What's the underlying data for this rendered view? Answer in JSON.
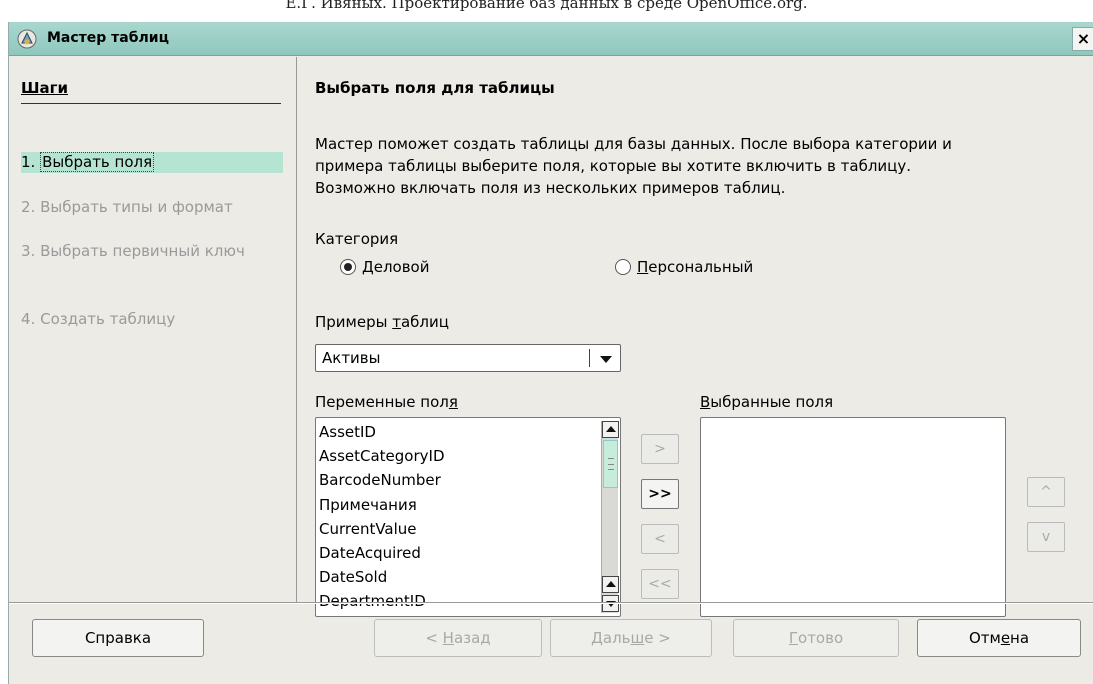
{
  "page_header": "Е.Г. Ивяных. Проектирование баз данных в среде OpenOffice.org.",
  "window": {
    "title": "Мастер таблиц",
    "icon": "wizard-icon",
    "close_label": "×"
  },
  "steps": {
    "title": "Шаги",
    "items": [
      {
        "number": "1.",
        "label": "Выбрать поля",
        "active": true
      },
      {
        "number": "2.",
        "label": "Выбрать типы и формат",
        "active": false
      },
      {
        "number": "3.",
        "label": "Выбрать первичный ключ",
        "active": false
      },
      {
        "number": "4.",
        "label": "Создать таблицу",
        "active": false
      }
    ]
  },
  "main": {
    "heading": "Выбрать поля для таблицы",
    "intro_lines": [
      "Мастер поможет создать таблицы для базы данных. После выбора категории и",
      "примера таблицы выберите поля, которые вы хотите включить в таблицу.",
      "Возможно включать поля из нескольких примеров таблиц."
    ],
    "category_label": "Категория",
    "category_options": [
      {
        "pre": "",
        "key": "Д",
        "post": "еловой",
        "selected": true
      },
      {
        "pre": "",
        "key": "П",
        "post": "ерсональный",
        "selected": false
      }
    ],
    "sample_tables_label": {
      "pre": "Примеры ",
      "key": "т",
      "post": "аблиц"
    },
    "sample_tables_value": "Активы",
    "available_fields_label": {
      "pre": "Переменные пол",
      "key": "я",
      "post": ""
    },
    "available_fields": [
      "AssetID",
      "AssetCategoryID",
      "BarcodeNumber",
      "Примечания",
      "CurrentValue",
      "DateAcquired",
      "DateSold",
      "DepartmentID"
    ],
    "selected_fields_label": {
      "pre": "",
      "key": "В",
      "post": "ыбранные поля"
    },
    "selected_fields": [],
    "move_buttons": {
      "add_one": ">",
      "add_all": ">>",
      "remove_one": "<",
      "remove_all": "<<",
      "move_up": "^",
      "move_down": "v"
    }
  },
  "footer": {
    "help": "Справка",
    "back": {
      "pre": "< ",
      "key": "Н",
      "post": "азад"
    },
    "next": {
      "pre": "Даль",
      "key": "ш",
      "post": "е >"
    },
    "finish": {
      "pre": "",
      "key": "Г",
      "post": "отово"
    },
    "cancel": {
      "pre": "Отм",
      "key": "е",
      "post": "на"
    }
  },
  "colors": {
    "titlebar": "#9fd2c8",
    "active_step": "#b6e4d2",
    "window_bg": "#ecebe6"
  }
}
